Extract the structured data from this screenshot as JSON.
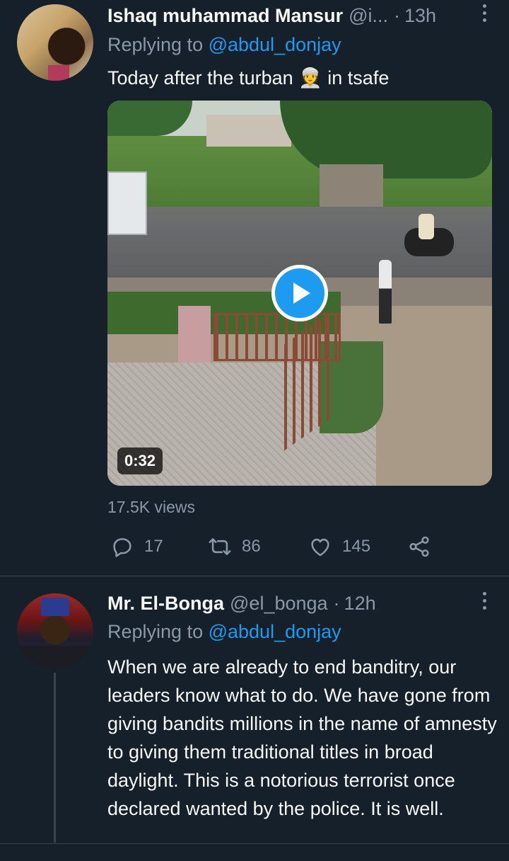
{
  "tweets": [
    {
      "name": "Ishaq muhammad Mansur",
      "handle": "@i...",
      "separator": "·",
      "time": "13h",
      "replying_prefix": "Replying to ",
      "replying_to": "@abdul_donjay",
      "text": "Today after the turban 👳 in tsafe",
      "video": {
        "duration": "0:32"
      },
      "views": "17.5K views",
      "actions": {
        "reply_count": "17",
        "retweet_count": "86",
        "like_count": "145"
      }
    },
    {
      "name": "Mr. El-Bonga",
      "handle": "@el_bonga",
      "separator": "·",
      "time": "12h",
      "replying_prefix": "Replying to ",
      "replying_to": "@abdul_donjay",
      "text": "When we are already to end banditry, our leaders know what to do. We have gone from giving bandits millions in the name of amnesty to giving them traditional titles in broad daylight. This is a notorious terrorist once declared wanted by the police. It is well."
    }
  ],
  "icons": {
    "more": "more-vertical-icon",
    "play": "play-icon",
    "reply": "reply-icon",
    "retweet": "retweet-icon",
    "like": "heart-icon",
    "share": "share-icon"
  },
  "colors": {
    "background": "#15202b",
    "accent": "#1d9bf0",
    "secondary_text": "#8b98a5",
    "primary_text": "#f7f9f9",
    "border": "#38444d"
  }
}
